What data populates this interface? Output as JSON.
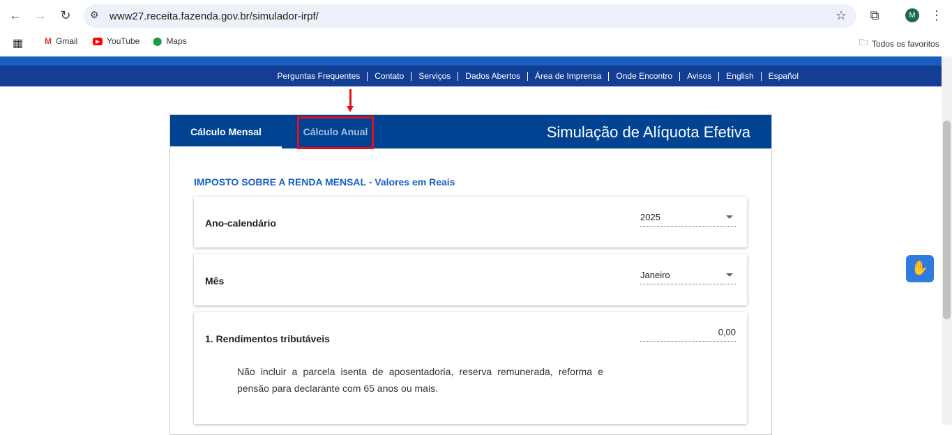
{
  "browser": {
    "url": "www27.receita.fazenda.gov.br/simulador-irpf/",
    "avatar": "M",
    "bookmarks": [
      {
        "label": "Gmail"
      },
      {
        "label": "YouTube"
      },
      {
        "label": "Maps"
      }
    ],
    "all_bookmarks": "Todos os favoritos"
  },
  "menu": [
    "Perguntas Frequentes",
    "Contato",
    "Serviços",
    "Dados Abertos",
    "Área de Imprensa",
    "Onde Encontro",
    "Avisos",
    "English",
    "Español"
  ],
  "tabs": [
    {
      "label": "Cálculo Mensal",
      "active": true
    },
    {
      "label": "Cálculo Anual",
      "active": false
    }
  ],
  "title": "Simulação de Alíquota Efetiva",
  "section": "IMPOSTO SOBRE A RENDA MENSAL - Valores em Reais",
  "fields": {
    "ano": {
      "label": "Ano-calendário",
      "value": "2025"
    },
    "mes": {
      "label": "Mês",
      "value": "Janeiro"
    },
    "rendimentos": {
      "label": "1. Rendimentos tributáveis",
      "value": "0,00",
      "note": "Não incluir a parcela isenta de aposentadoria, reserva remunerada, reforma e pensão para declarante com 65 anos ou mais."
    }
  },
  "colors": {
    "header": "#004393",
    "menu": "#123f93",
    "highlight": "#e0101a",
    "section": "#1a5fc0"
  }
}
